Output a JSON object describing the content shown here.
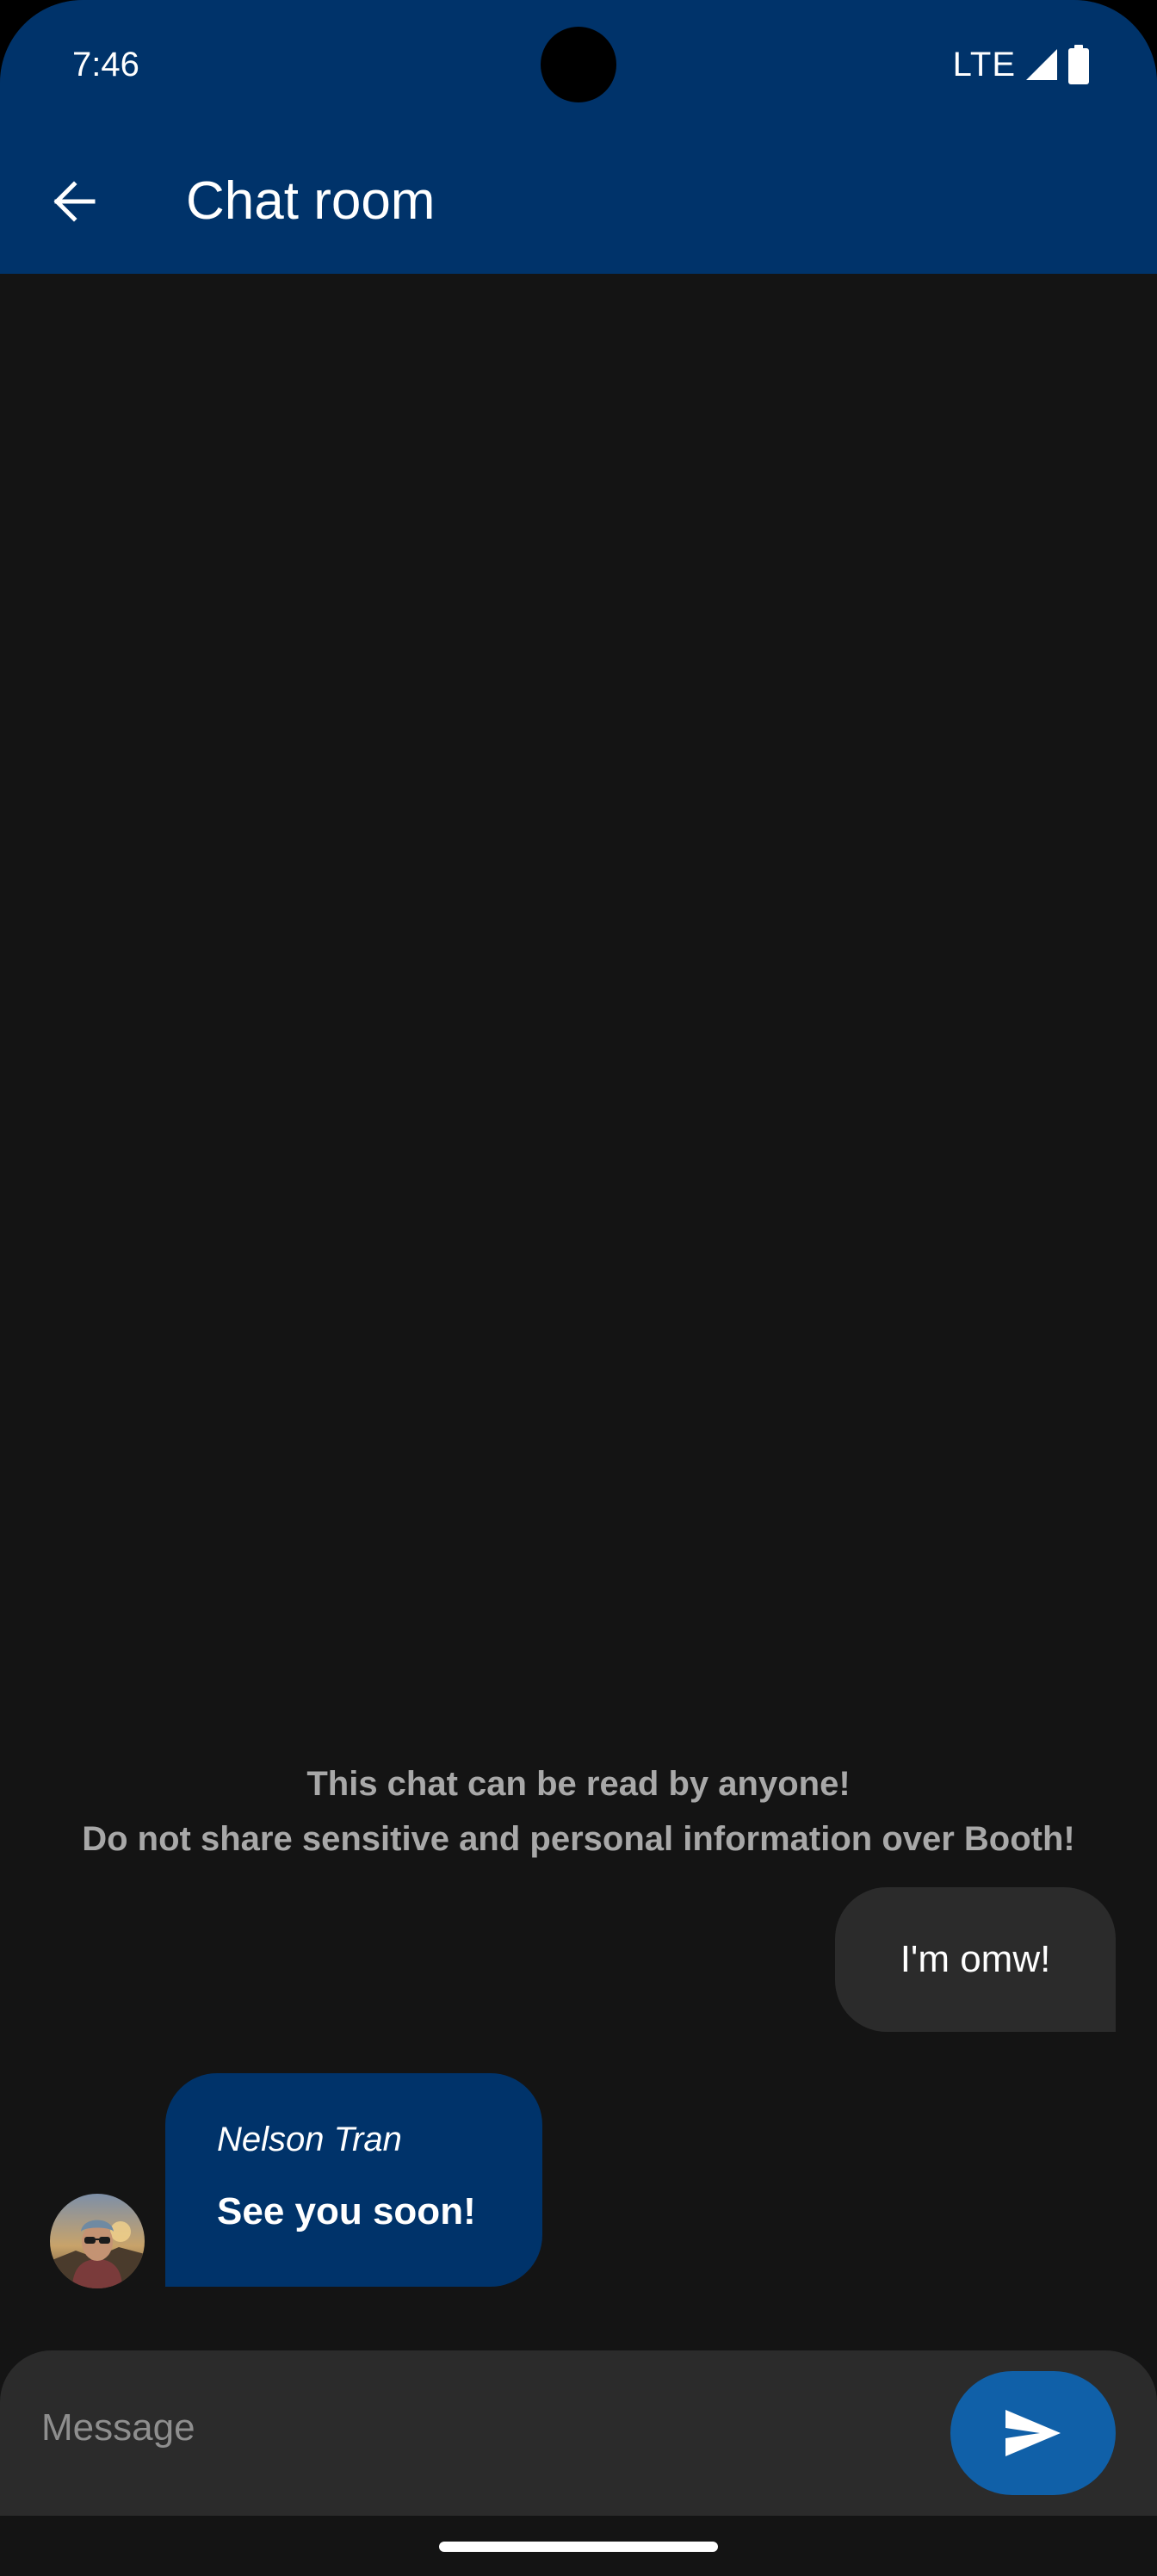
{
  "status_bar": {
    "time": "7:46",
    "network": "LTE",
    "signal_icon": "cellular-signal-icon",
    "battery_icon": "battery-icon"
  },
  "app_bar": {
    "back_icon": "arrow-back-icon",
    "title": "Chat room"
  },
  "chat": {
    "notice_line1": "This chat can be read by anyone!",
    "notice_line2": "Do not share sensitive and personal information over Booth!",
    "messages": [
      {
        "direction": "outgoing",
        "text": "I'm omw!"
      },
      {
        "direction": "incoming",
        "sender": "Nelson Tran",
        "text": "See you soon!"
      }
    ]
  },
  "composer": {
    "placeholder": "Message",
    "value": "",
    "send_icon": "send-icon"
  },
  "colors": {
    "header": "#00336a",
    "background": "#141414",
    "outgoing_bubble": "#2b2b2b",
    "incoming_bubble": "#00336a",
    "send_button": "#1060a8",
    "notice_text": "#a8a8a8"
  }
}
